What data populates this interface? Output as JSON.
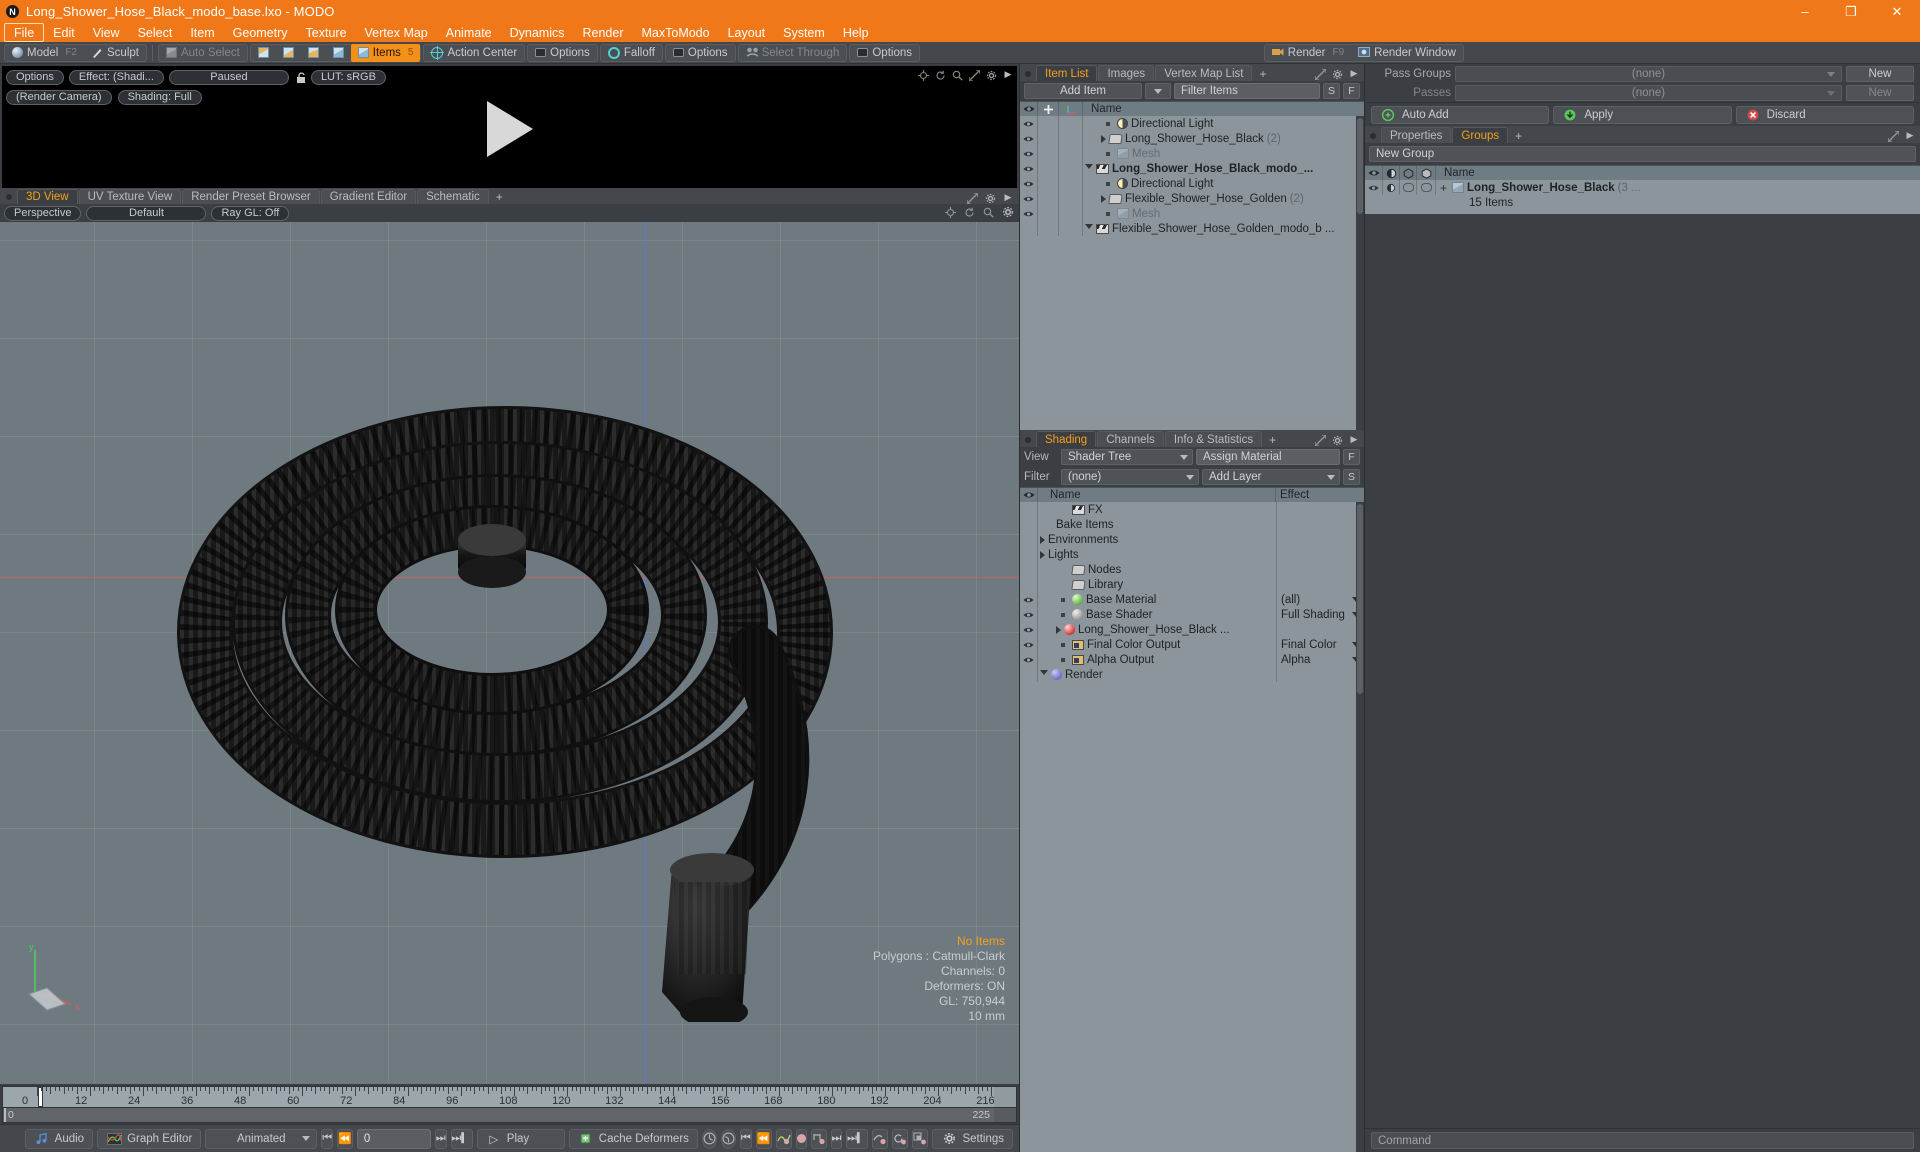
{
  "window": {
    "title": "Long_Shower_Hose_Black_modo_base.lxo - MODO",
    "minimize": "–",
    "maximize": "❐",
    "close": "✕"
  },
  "menu": {
    "items": [
      "File",
      "Edit",
      "View",
      "Select",
      "Item",
      "Geometry",
      "Texture",
      "Vertex Map",
      "Animate",
      "Dynamics",
      "Render",
      "MaxToModo",
      "Layout",
      "System",
      "Help"
    ],
    "active": "File"
  },
  "modebar": {
    "model": "Model",
    "model_key": "F2",
    "sculpt": "Sculpt",
    "auto_select": "Auto Select",
    "items": "Items",
    "items_key": "5",
    "action_center": "Action Center",
    "options1": "Options",
    "falloff": "Falloff",
    "options2": "Options",
    "select_through": "Select Through",
    "options3": "Options",
    "render": "Render",
    "render_key": "F9",
    "render_window": "Render Window"
  },
  "render_preview": {
    "options": "Options",
    "effect": "Effect: (Shadi...",
    "paused": "Paused",
    "lut": "LUT: sRGB",
    "render_camera": "(Render Camera)",
    "shading": "Shading: Full"
  },
  "viewport": {
    "tabs": [
      "3D View",
      "UV Texture View",
      "Render Preset Browser",
      "Gradient Editor",
      "Schematic"
    ],
    "active_tab": "3D View",
    "add_tab": "+",
    "perspective": "Perspective",
    "preset": "Default",
    "raygl": "Ray GL: Off",
    "status": {
      "items": "No Items",
      "polygons": "Polygons : Catmull-Clark",
      "channels": "Channels: 0",
      "deformers": "Deformers: ON",
      "gl": "GL: 750,944",
      "scale": "10 mm"
    }
  },
  "timeline": {
    "labels": [
      "0",
      "12",
      "24",
      "36",
      "48",
      "60",
      "72",
      "84",
      "96",
      "108",
      "120",
      "132",
      "144",
      "156",
      "168",
      "180",
      "192",
      "204",
      "216"
    ],
    "start": "0",
    "end": "225",
    "range_end": "225"
  },
  "bottombar": {
    "audio": "Audio",
    "graph_editor": "Graph Editor",
    "mode": "Animated",
    "frame": "0",
    "play": "Play",
    "cache_deformers": "Cache Deformers",
    "settings": "Settings"
  },
  "item_list": {
    "tabs": [
      "Item List",
      "Images",
      "Vertex Map List"
    ],
    "active_tab": "Item List",
    "add_tab": "+",
    "add_item": "Add Item",
    "filter_items": "Filter Items",
    "btn_s": "S",
    "btn_f": "F",
    "col_name": "Name",
    "rows": [
      {
        "indent": 0,
        "icon": "clapboard-icon",
        "label": "Flexible_Shower_Hose_Golden_modo_b ...",
        "bold": false,
        "count": "",
        "twirl": "down",
        "eye": false,
        "dim": false
      },
      {
        "indent": 1,
        "icon": "mesh-icon",
        "label": "Mesh",
        "bold": false,
        "count": "",
        "twirl": "leaf",
        "eye": true,
        "dim": true
      },
      {
        "indent": 1,
        "icon": "folder-icon",
        "label": "Flexible_Shower_Hose_Golden",
        "bold": false,
        "count": "(2)",
        "twirl": "right",
        "eye": true,
        "dim": false
      },
      {
        "indent": 1,
        "icon": "light-icon",
        "label": "Directional Light",
        "bold": false,
        "count": "",
        "twirl": "leaf",
        "eye": true,
        "dim": false
      },
      {
        "indent": 0,
        "icon": "clapboard-icon",
        "label": "Long_Shower_Hose_Black_modo_...",
        "bold": true,
        "count": "",
        "twirl": "down",
        "eye": true,
        "dim": false
      },
      {
        "indent": 1,
        "icon": "mesh-icon",
        "label": "Mesh",
        "bold": false,
        "count": "",
        "twirl": "leaf",
        "eye": true,
        "dim": true
      },
      {
        "indent": 1,
        "icon": "folder-icon",
        "label": "Long_Shower_Hose_Black",
        "bold": false,
        "count": "(2)",
        "twirl": "right",
        "eye": true,
        "dim": false
      },
      {
        "indent": 1,
        "icon": "light-icon",
        "label": "Directional Light",
        "bold": false,
        "count": "",
        "twirl": "leaf",
        "eye": true,
        "dim": false
      }
    ]
  },
  "shading": {
    "tabs": [
      "Shading",
      "Channels",
      "Info & Statistics"
    ],
    "active_tab": "Shading",
    "add_tab": "+",
    "view_label": "View",
    "view_value": "Shader Tree",
    "assign_material": "Assign Material",
    "btn_f": "F",
    "filter_label": "Filter",
    "filter_value": "(none)",
    "add_layer": "Add Layer",
    "btn_s": "S",
    "col_name": "Name",
    "col_effect": "Effect",
    "rows": [
      {
        "indent": 0,
        "icon": "render-ball-icon",
        "label": "Render",
        "effect": "",
        "twirl": "down",
        "eye": false
      },
      {
        "indent": 1,
        "icon": "image-icon",
        "label": "Alpha Output",
        "effect": "Alpha",
        "twirl": "leaf",
        "eye": true
      },
      {
        "indent": 1,
        "icon": "image-icon",
        "label": "Final Color Output",
        "effect": "Final Color",
        "twirl": "leaf",
        "eye": true
      },
      {
        "indent": 1,
        "icon": "material-icon",
        "label": "Long_Shower_Hose_Black ...",
        "effect": "",
        "twirl": "right",
        "eye": true
      },
      {
        "indent": 1,
        "icon": "shader-icon",
        "label": "Base Shader",
        "effect": "Full Shading",
        "twirl": "leaf",
        "eye": true
      },
      {
        "indent": 1,
        "icon": "material-green-icon",
        "label": "Base Material",
        "effect": "(all)",
        "twirl": "leaf",
        "eye": true
      },
      {
        "indent": 1,
        "icon": "folder-icon",
        "label": "Library",
        "effect": "",
        "twirl": "none",
        "eye": false
      },
      {
        "indent": 1,
        "icon": "folder-icon",
        "label": "Nodes",
        "effect": "",
        "twirl": "none",
        "eye": false
      },
      {
        "indent": 0,
        "icon": "none",
        "label": "Lights",
        "effect": "",
        "twirl": "right",
        "eye": false
      },
      {
        "indent": 0,
        "icon": "none",
        "label": "Environments",
        "effect": "",
        "twirl": "right",
        "eye": false
      },
      {
        "indent": 0,
        "icon": "none",
        "label": "Bake Items",
        "effect": "",
        "twirl": "none",
        "eye": false
      },
      {
        "indent": 1,
        "icon": "clapboard-icon",
        "label": "FX",
        "effect": "",
        "twirl": "none",
        "eye": false
      }
    ]
  },
  "passes": {
    "pass_groups_label": "Pass Groups",
    "pass_groups_value": "(none)",
    "pass_groups_new": "New",
    "passes_label": "Passes",
    "passes_value": "(none)",
    "passes_new": "New",
    "auto_add": "Auto Add",
    "apply": "Apply",
    "discard": "Discard"
  },
  "groups": {
    "tabs": [
      "Properties",
      "Groups"
    ],
    "active_tab": "Groups",
    "add_tab": "+",
    "new_group": "New Group",
    "col_name": "Name",
    "item_label": "Long_Shower_Hose_Black",
    "item_count": "(3 ...",
    "item_sub": "15 Items"
  },
  "command": {
    "placeholder": "Command"
  },
  "colors": {
    "accent_orange": "#f07818",
    "tab_orange": "#f3a01a",
    "panel_bg": "#3b3f43",
    "list_bg": "#8b959b",
    "viewport_bg": "#6e7a80"
  }
}
